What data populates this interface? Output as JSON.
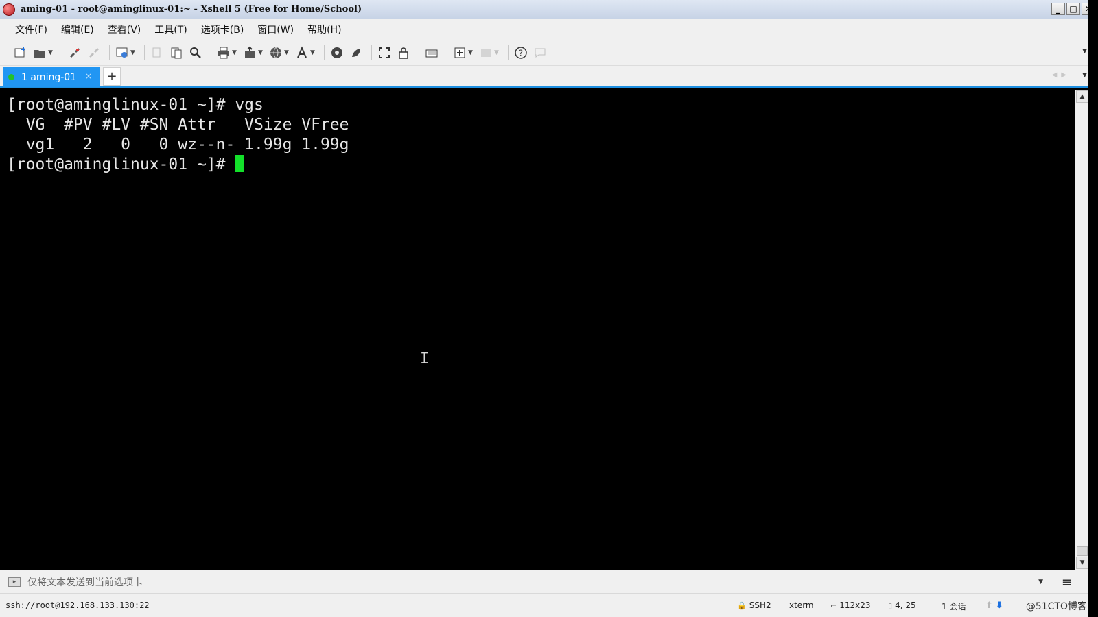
{
  "window": {
    "title": "aming-01 - root@aminglinux-01:~ - Xshell 5 (Free for Home/School)",
    "controls": {
      "minimize": "_",
      "maximize": "□",
      "close": "✕"
    }
  },
  "menu": {
    "items": [
      "文件(F)",
      "编辑(E)",
      "查看(V)",
      "工具(T)",
      "选项卡(B)",
      "窗口(W)",
      "帮助(H)"
    ]
  },
  "toolbar": {
    "icons": [
      "new-session-icon",
      "open-icon",
      "reconnect-icon",
      "disconnect-icon",
      "properties-icon",
      "copy-icon",
      "paste-icon",
      "find-icon",
      "print-icon",
      "transfer-icon",
      "globe-icon",
      "font-icon",
      "xftp-icon",
      "xagent-icon",
      "fullscreen-icon",
      "lock-icon",
      "keyboard-icon",
      "new-tab-icon",
      "layout-icon",
      "help-icon",
      "chat-icon"
    ]
  },
  "tabs": {
    "items": [
      {
        "label": "1 aming-01",
        "active": true,
        "status_color": "#24c12a"
      }
    ],
    "add_label": "+",
    "close_label": "×"
  },
  "terminal": {
    "lines": [
      "[root@aminglinux-01 ~]# vgs",
      "  VG  #PV #LV #SN Attr   VSize VFree",
      "  vg1   2   0   0 wz--n- 1.99g 1.99g",
      "[root@aminglinux-01 ~]# "
    ],
    "cursor_color": "#13e02a",
    "text_color": "#e6e6e6",
    "background": "#000000"
  },
  "compose": {
    "placeholder": "仅将文本发送到当前选项卡"
  },
  "status": {
    "connection": "ssh://root@192.168.133.130:22",
    "protocol": "SSH2",
    "terminal_type": "xterm",
    "size": "112x23",
    "cursor_pos": "4, 25",
    "sessions": "1 会话",
    "watermark": "@51CTO博客"
  },
  "colors": {
    "accent": "#2196f3",
    "tab_underline": "#1e8fe0"
  }
}
